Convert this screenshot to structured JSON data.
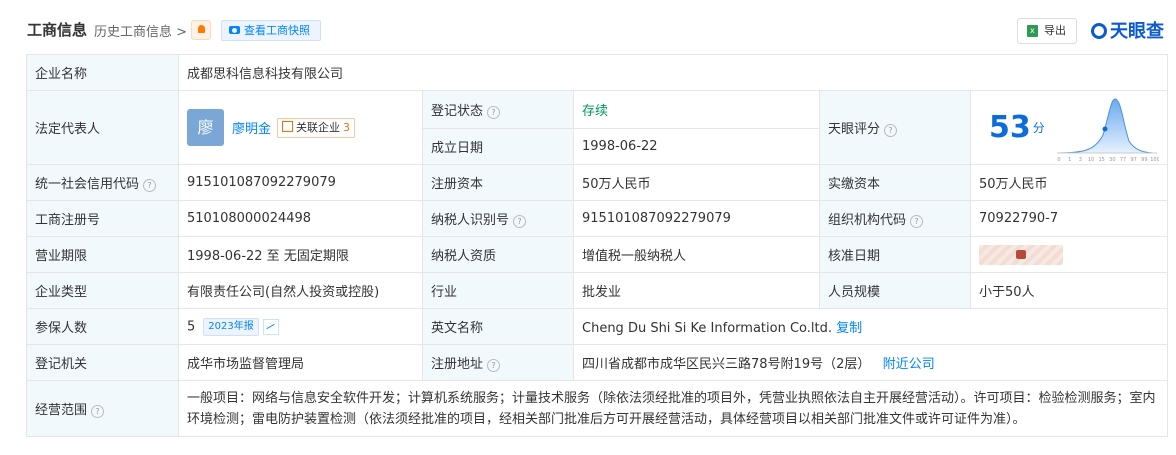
{
  "header": {
    "title": "工商信息",
    "history": "历史工商信息 >",
    "snapshot": "查看工商快照",
    "export": "导出",
    "brand": "天眼查"
  },
  "rows": {
    "company_name_label": "企业名称",
    "company_name": "成都思科信息科技有限公司",
    "legal_rep_label": "法定代表人",
    "legal_rep_avatar": "廖",
    "legal_rep_name": "廖明金",
    "related_label": "关联企业",
    "related_count": "3",
    "reg_status_label": "登记状态",
    "reg_status": "存续",
    "found_date_label": "成立日期",
    "found_date": "1998-06-22",
    "score_label": "天眼评分",
    "score": "53",
    "score_unit": "分",
    "score_axis": [
      "0",
      "1",
      "3",
      "10",
      "15",
      "30",
      "77",
      "97",
      "99",
      "100"
    ],
    "credit_code_label": "统一社会信用代码",
    "credit_code": "915101087092279079",
    "reg_capital_label": "注册资本",
    "reg_capital": "50万人民币",
    "paid_capital_label": "实缴资本",
    "paid_capital": "50万人民币",
    "reg_no_label": "工商注册号",
    "reg_no": "510108000024498",
    "tax_id_label": "纳税人识别号",
    "tax_id": "915101087092279079",
    "org_code_label": "组织机构代码",
    "org_code": "70922790-7",
    "term_label": "营业期限",
    "term": "1998-06-22 至 无固定期限",
    "taxpayer_label": "纳税人资质",
    "taxpayer": "增值税一般纳税人",
    "approve_label": "核准日期",
    "type_label": "企业类型",
    "type": "有限责任公司(自然人投资或控股)",
    "industry_label": "行业",
    "industry": "批发业",
    "staff_label": "人员规模",
    "staff": "小于50人",
    "insured_label": "参保人数",
    "insured": "5",
    "insured_year": "2023年报",
    "en_name_label": "英文名称",
    "en_name": "Cheng Du Shi Si Ke Information Co.ltd.",
    "copy": "复制",
    "authority_label": "登记机关",
    "authority": "成华市场监督管理局",
    "address_label": "注册地址",
    "address": "四川省成都市成华区民兴三路78号附19号（2层）",
    "nearby": "附近公司",
    "scope_label": "经营范围",
    "scope": "一般项目：网络与信息安全软件开发；计算机系统服务；计量技术服务（除依法须经批准的项目外，凭营业执照依法自主开展经营活动）。许可项目：检验检测服务；室内环境检测；雷电防护装置检测（依法须经批准的项目，经相关部门批准后方可开展经营活动，具体经营项目以相关部门批准文件或许可证件为准）。"
  },
  "colors": {
    "accent": "#0084ff",
    "status": "#009a61",
    "label_bg": "#f2f9fc"
  }
}
